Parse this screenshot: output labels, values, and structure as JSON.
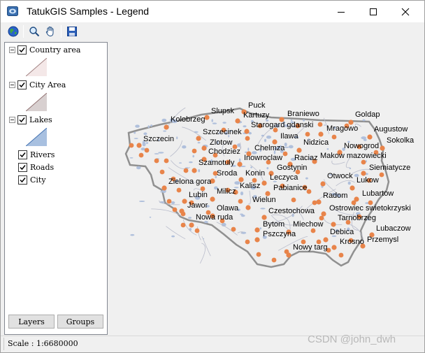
{
  "window": {
    "title": "TatukGIS Samples - Legend"
  },
  "toolbar": {
    "buttons": [
      "globe-icon",
      "zoom-icon",
      "pan-hand-icon",
      "save-icon"
    ]
  },
  "legend": {
    "layers": [
      {
        "label": "Country area",
        "checked": true,
        "expandable": true,
        "fill": "#f4e8e8",
        "stroke": "#a08080"
      },
      {
        "label": "City Area",
        "checked": true,
        "expandable": true,
        "fill": "#d8d0d0",
        "stroke": "#907070"
      },
      {
        "label": "Lakes",
        "checked": true,
        "expandable": true,
        "fill": "#a8c0e0",
        "stroke": "#4070b0"
      },
      {
        "label": "Rivers",
        "checked": true,
        "expandable": false
      },
      {
        "label": "Roads",
        "checked": true,
        "expandable": false
      },
      {
        "label": "City",
        "checked": true,
        "expandable": false
      }
    ],
    "tabs": [
      "Layers",
      "Groups"
    ]
  },
  "map": {
    "colors": {
      "country": "#eeeeee",
      "border": "#909090",
      "lakes": "#b0c0dc",
      "city_dot": "#e8844a"
    },
    "cities": [
      "Puck",
      "Braniewo",
      "Goldap",
      "Slupsk",
      "Kartuzy",
      "Kolobrzeg",
      "Starogard gdanski",
      "Mragowo",
      "Augustow",
      "Szczecinek",
      "Ilawa",
      "Sokolka",
      "Szczecin",
      "Zlotow",
      "Nidzica",
      "Nowogrod",
      "Chelmza",
      "Chodziez",
      "Raciaz",
      "Makow mazowiecki",
      "Szamotuly",
      "Inowroclaw",
      "Siemiatycze",
      "Sroda",
      "Konin",
      "Gostynin",
      "Otwock",
      "Zielona gora",
      "Leczyca",
      "Lukow",
      "Kalisz",
      "Pabianice",
      "Milicz",
      "Lubin",
      "Lubartow",
      "Wielun",
      "Radom",
      "Jawor",
      "Olawa",
      "Czestochowa",
      "Ostrowiec swietokrzyski",
      "Nowa ruda",
      "Tarnobrzeg",
      "Bytom",
      "Miechow",
      "Lubaczow",
      "Pszczyna",
      "Debica",
      "Przemysl",
      "Krosno",
      "Nowy targ"
    ]
  },
  "status": {
    "scale_label": "Scale : 1:6680000"
  },
  "watermark": "CSDN @john_dwh"
}
